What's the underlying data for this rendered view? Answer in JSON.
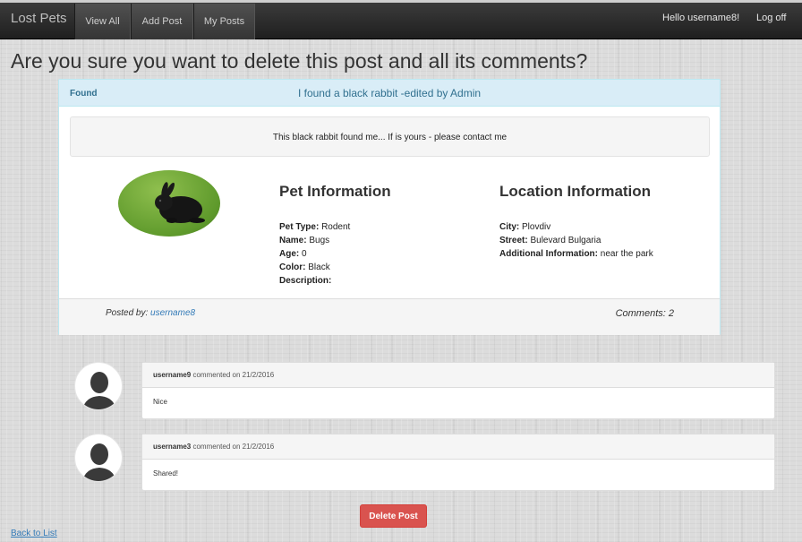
{
  "navbar": {
    "brand": "Lost Pets",
    "items": [
      {
        "label": "View All"
      },
      {
        "label": "Add Post"
      },
      {
        "label": "My Posts"
      }
    ],
    "greeting": "Hello username8!",
    "logoff": "Log off"
  },
  "page": {
    "title": "Are you sure you want to delete this post and all its comments?"
  },
  "post": {
    "status": "Found",
    "title": "I found a black rabbit -edited by Admin",
    "body": "This black rabbit found me... If is yours - please contact me",
    "pet_info": {
      "heading": "Pet Information",
      "type_label": "Pet Type:",
      "type": "Rodent",
      "name_label": "Name:",
      "name": "Bugs",
      "age_label": "Age:",
      "age": "0",
      "color_label": "Color:",
      "color": "Black",
      "description_label": "Description:",
      "description": ""
    },
    "location_info": {
      "heading": "Location Information",
      "city_label": "City:",
      "city": "Plovdiv",
      "street_label": "Street:",
      "street": "Bulevard Bulgaria",
      "additional_label": "Additional Information:",
      "additional": "near the park"
    },
    "posted_by_label": "Posted by:",
    "posted_by": "username8",
    "comments_label": "Comments: 2"
  },
  "comments": [
    {
      "user": "username9",
      "meta": "commented on 21/2/2016",
      "text": "Nice"
    },
    {
      "user": "username3",
      "meta": "commented on 21/2/2016",
      "text": "Shared!"
    }
  ],
  "actions": {
    "delete_label": "Delete Post",
    "back_label": "Back to List"
  },
  "colors": {
    "navbar": "#222222",
    "panel_header": "#d9edf7",
    "link": "#337ab7",
    "danger": "#d9534f"
  }
}
